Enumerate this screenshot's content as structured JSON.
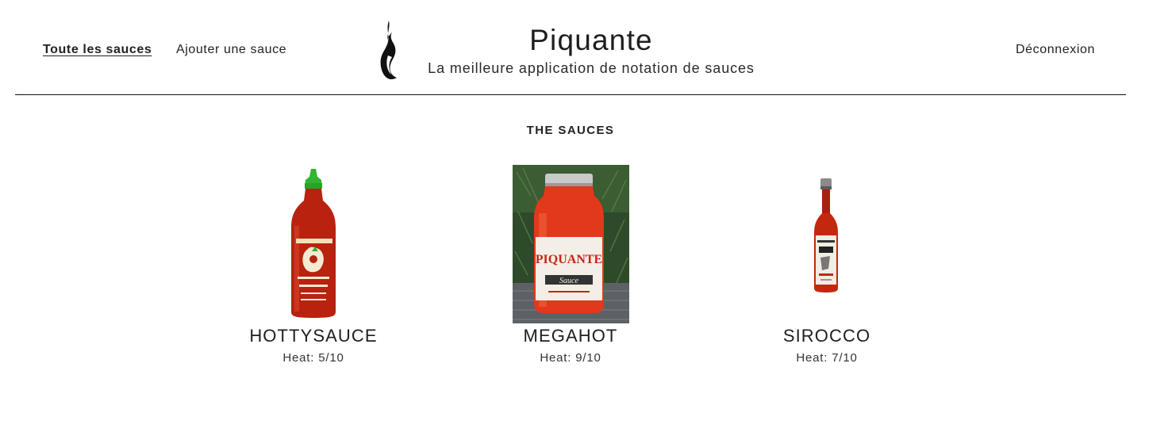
{
  "nav": {
    "all_sauces": "Toute les sauces",
    "add_sauce": "Ajouter une sauce",
    "logout": "Déconnexion"
  },
  "brand": {
    "title": "Piquante",
    "subtitle": "La meilleure application de notation de sauces",
    "logo_icon": "flame-icon"
  },
  "section": {
    "title": "THE SAUCES"
  },
  "sauces": [
    {
      "name": "HOTTYSAUCE",
      "heat": "Heat: 5/10",
      "image": "sriracha-bottle-image"
    },
    {
      "name": "MEGAHOT",
      "heat": "Heat: 9/10",
      "image": "piquante-jar-image",
      "label_text": "PIQUANTE",
      "label_sub": "Sauce"
    },
    {
      "name": "SIROCCO",
      "heat": "Heat: 7/10",
      "image": "small-hot-sauce-bottle-image"
    }
  ],
  "colors": {
    "text": "#222222",
    "sauce_red": "#b8220f",
    "cap_green": "#2fb52f",
    "divider": "#111111"
  }
}
